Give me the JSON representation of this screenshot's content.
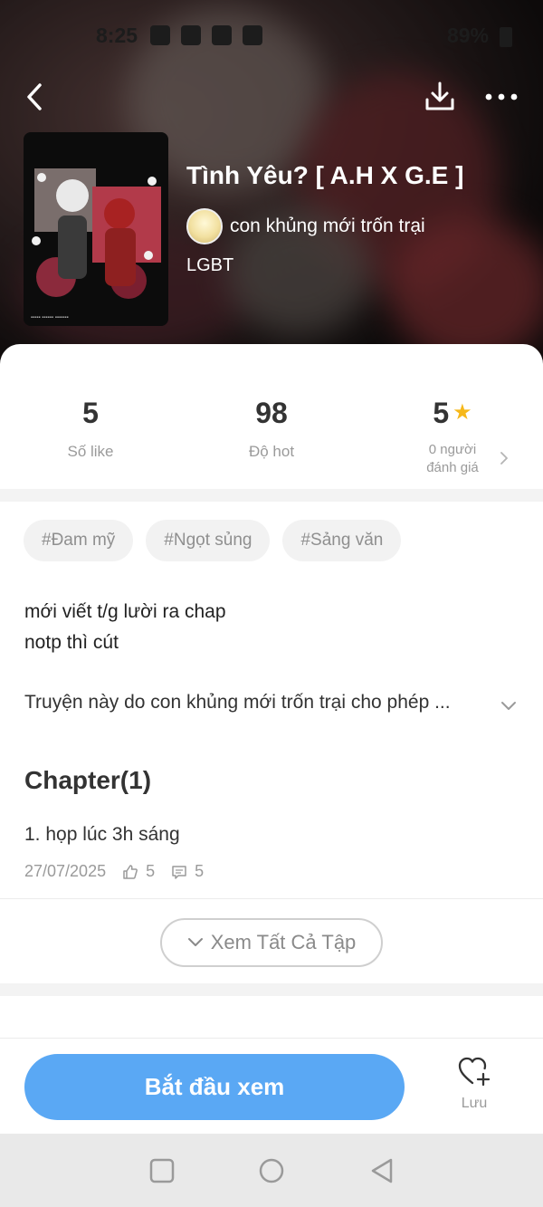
{
  "status_bar": {
    "time": "8:25",
    "battery": "89%"
  },
  "book": {
    "title": "Tình Yêu? [ A.H X G.E ]",
    "author": "con khủng mới trốn trại",
    "genre": "LGBT"
  },
  "stats": {
    "likes": {
      "value": "5",
      "label": "Số like"
    },
    "hot": {
      "value": "98",
      "label": "Độ hot"
    },
    "rating": {
      "value": "5",
      "label_line1": "0 người",
      "label_line2": "đánh giá"
    }
  },
  "tags": [
    "#Đam mỹ",
    "#Ngọt sủng",
    "#Sảng văn"
  ],
  "description": {
    "line1": "mới viết t/g lười ra chap",
    "line2": "notp thì cút",
    "permission": "Truyện này do con khủng mới trốn trại cho phép ..."
  },
  "chapters": {
    "heading": "Chapter(1)",
    "items": [
      {
        "title": "1. họp lúc 3h sáng",
        "date": "27/07/2025",
        "likes": "5",
        "comments": "5"
      }
    ],
    "see_all_label": "Xem Tất Cả Tập"
  },
  "actions": {
    "start_label": "Bắt đầu xem",
    "save_label": "Lưu"
  },
  "colors": {
    "primary": "#5aa8f4",
    "star": "#f6b81a",
    "tag_bg": "#f2f2f2"
  },
  "icons": [
    "back-arrow-icon",
    "download-icon",
    "more-dots-icon",
    "star-icon",
    "chevron-right-icon",
    "chevron-down-icon",
    "thumbs-up-icon",
    "comment-icon",
    "heart-plus-icon"
  ]
}
